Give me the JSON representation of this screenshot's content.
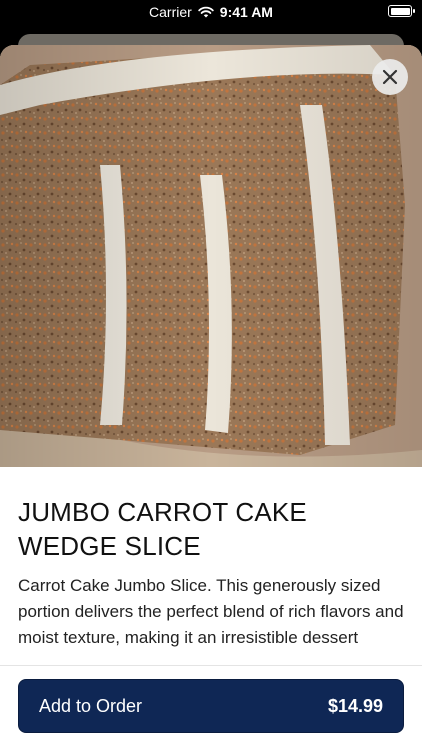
{
  "status_bar": {
    "carrier": "Carrier",
    "time": "9:41 AM"
  },
  "item": {
    "image_subject": "carrot-cake-slice-photo",
    "title": "JUMBO CARROT CAKE WEDGE SLICE",
    "description": "Carrot Cake Jumbo Slice. This generously sized portion delivers the perfect blend of rich flavors and moist texture, making it an irresistible dessert"
  },
  "footer": {
    "add_label": "Add to Order",
    "price": "$14.99"
  },
  "colors": {
    "primary_button": "#0f2755",
    "sheet_background": "#ffffff"
  },
  "icons": {
    "close": "close-icon",
    "wifi": "wifi-icon",
    "battery": "battery-icon"
  }
}
